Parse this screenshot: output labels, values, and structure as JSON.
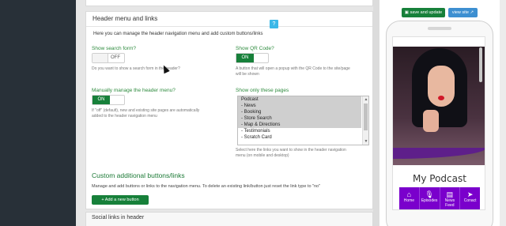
{
  "header_menu": {
    "title": "Header menu and links",
    "description": "Here you can manage the header navigation menu and add custom buttons/links",
    "help_icon": "?",
    "search": {
      "label": "Show search form?",
      "toggle": "OFF",
      "note": "Do you want to show a search form in the header?"
    },
    "qr": {
      "label": "Show QR Code?",
      "toggle": "ON",
      "note_line1": "A button that will open a popup with the QR Code to the site/page",
      "note_line2": "will be shown"
    },
    "manual": {
      "label": "Manually manage the header menu?",
      "toggle": "ON",
      "note_line1": "If \"off\" (default), new and existing site pages are automatically",
      "note_line2": "added to the header navigation menu"
    },
    "pages": {
      "label": "Show only these pages",
      "options": [
        {
          "text": "Podcast",
          "selected": true
        },
        {
          "text": "- News",
          "selected": true
        },
        {
          "text": "- Booking",
          "selected": true
        },
        {
          "text": "- Store Search",
          "selected": true
        },
        {
          "text": "- Map & Directions",
          "selected": true
        },
        {
          "text": "- Testimonials",
          "selected": false
        },
        {
          "text": "- Scratch Card",
          "selected": false
        }
      ],
      "note_line1": "Select here the links you want to show in the header navigation",
      "note_line2": "menu (on mobile and desktop)"
    }
  },
  "custom": {
    "title": "Custom additional buttons/links",
    "description": "Manage and add buttons or links to the navigation menu. To delete an existing link/button just reset the link type to \"no\"",
    "add_button": "+ Add a new button"
  },
  "social": {
    "title": "Social links in header"
  },
  "toolbar": {
    "save": "save and update",
    "view": "view site"
  },
  "preview": {
    "app_title": "My Podcast",
    "nav": [
      {
        "icon": "home-icon",
        "glyph": "⌂",
        "label": "Home"
      },
      {
        "icon": "microphone-icon",
        "glyph": "🎙",
        "label": "Episodes"
      },
      {
        "icon": "newspaper-icon",
        "glyph": "▤",
        "label": "News Feed"
      },
      {
        "icon": "send-icon",
        "glyph": "➤",
        "label": "Conact"
      }
    ]
  },
  "colors": {
    "green": "#17803a",
    "blue": "#3d8fd1",
    "nav_purple": "#7a00cc",
    "help_blue": "#3ab8e8"
  }
}
